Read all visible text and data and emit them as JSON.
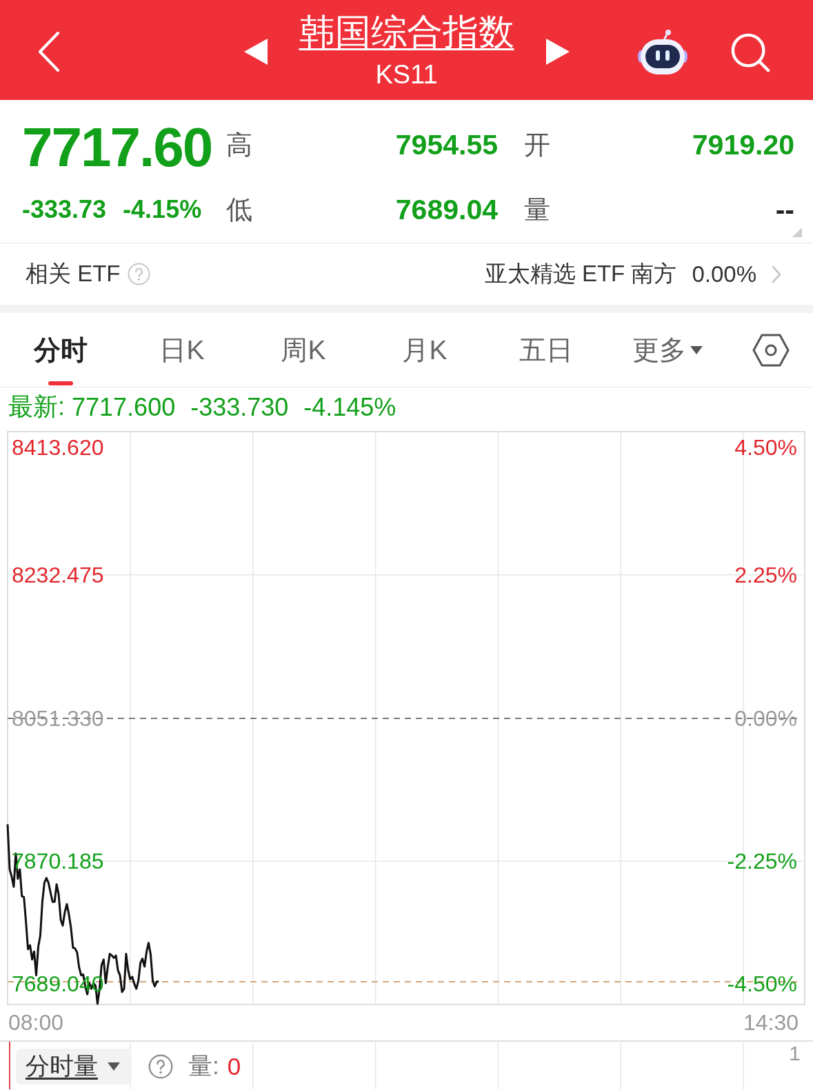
{
  "header": {
    "title": "韩国综合指数",
    "code": "KS11"
  },
  "quote": {
    "price": "7717.60",
    "change": "-333.73",
    "change_percent": "-4.15%",
    "stats": [
      {
        "label": "高",
        "value": "7954.55",
        "color": "#12a01a"
      },
      {
        "label": "开",
        "value": "7919.20",
        "color": "#12a01a"
      },
      {
        "label": "低",
        "value": "7689.04",
        "color": "#12a01a"
      },
      {
        "label": "量",
        "value": "--",
        "color": "#222222"
      }
    ]
  },
  "related_etf": {
    "label": "相关 ETF",
    "name": "亚太精选 ETF 南方",
    "change": "0.00%"
  },
  "tabs": [
    {
      "label": "分时",
      "selected": true,
      "kind": "tab"
    },
    {
      "label": "日K",
      "selected": false,
      "kind": "tab"
    },
    {
      "label": "周K",
      "selected": false,
      "kind": "tab"
    },
    {
      "label": "月K",
      "selected": false,
      "kind": "tab"
    },
    {
      "label": "五日",
      "selected": false,
      "kind": "tab"
    },
    {
      "label": "更多",
      "selected": false,
      "kind": "dropdown"
    }
  ],
  "intraday": {
    "latest": {
      "label": "最新:",
      "price": "7717.600",
      "change": "-333.730",
      "percent": "-4.145%"
    },
    "chart_data": {
      "type": "line",
      "categories": [
        null,
        null,
        null,
        null,
        null,
        null,
        null,
        null,
        null,
        null,
        null,
        null,
        null,
        null,
        null,
        null,
        null,
        null,
        null,
        null,
        null,
        null,
        null,
        null,
        null,
        null,
        null,
        null,
        null,
        null,
        null,
        null,
        null,
        null,
        null,
        null,
        null,
        null,
        null,
        null,
        null,
        null,
        null,
        null,
        null,
        null,
        null,
        null,
        null,
        null,
        null,
        null,
        null,
        null,
        null,
        null,
        null,
        null,
        null,
        null,
        null,
        null,
        null,
        null,
        null,
        null,
        null,
        null,
        null,
        null,
        null,
        null,
        null,
        null,
        null,
        null,
        null,
        null,
        null,
        null,
        null,
        null,
        null,
        null,
        null,
        null,
        null,
        null,
        null,
        null,
        null,
        null,
        null,
        null,
        null,
        null,
        null,
        null,
        null,
        null,
        null,
        null,
        null,
        null,
        null,
        null,
        null,
        null,
        null,
        null,
        null,
        null,
        null,
        null,
        null,
        null,
        null,
        null,
        null,
        null,
        null,
        null,
        null,
        null,
        null,
        null,
        null,
        null,
        null,
        null,
        null,
        null,
        null,
        null,
        null,
        null,
        null,
        null,
        null,
        null,
        null,
        null,
        null,
        null,
        null,
        null,
        null,
        null,
        null,
        null,
        null,
        null,
        null,
        null,
        null,
        null,
        null,
        null,
        null,
        null,
        null,
        null,
        null,
        null,
        null,
        null,
        null,
        null,
        null,
        null,
        null,
        null,
        null,
        null,
        null,
        null,
        null,
        null,
        null,
        null,
        null,
        null,
        null,
        null,
        null,
        null,
        null,
        null,
        null,
        null,
        null,
        null,
        null,
        null,
        null,
        null,
        null,
        null,
        null,
        null,
        null,
        null,
        null,
        null,
        null,
        null,
        null,
        null,
        null,
        null,
        null,
        null,
        null,
        null,
        null,
        null,
        null,
        null,
        null,
        null,
        null,
        null,
        null,
        null,
        null,
        null,
        null,
        null,
        null,
        null,
        null,
        null,
        null,
        null,
        null,
        null,
        null,
        null,
        null,
        null,
        null,
        null,
        null,
        null,
        null,
        null,
        null,
        null,
        null,
        null,
        null,
        null,
        null,
        null,
        null,
        null,
        null,
        null,
        null,
        null,
        null,
        null,
        null,
        null,
        null,
        null,
        null,
        null,
        null,
        null,
        null,
        null,
        null,
        null,
        null,
        null,
        null,
        null,
        null,
        null,
        null,
        null,
        null,
        null,
        null,
        null,
        null,
        null,
        null,
        null,
        null,
        null,
        null,
        null,
        null,
        null,
        null,
        null,
        null,
        null,
        null,
        null,
        null,
        null,
        null,
        null,
        null,
        null,
        null,
        null,
        null,
        null,
        null,
        null,
        null,
        null,
        null,
        null,
        null,
        null,
        null,
        null,
        null,
        null,
        null,
        null,
        null,
        null,
        null,
        null,
        null,
        null,
        null,
        null,
        null,
        null,
        null,
        null,
        null,
        null,
        null,
        null,
        null,
        null,
        null,
        null,
        null,
        null,
        null,
        null,
        null,
        null,
        null,
        null,
        null,
        null,
        null,
        null,
        null,
        null,
        null,
        null,
        null,
        null,
        null,
        null,
        null,
        null,
        null,
        null,
        null,
        null,
        null,
        null,
        null,
        null,
        null,
        null,
        null,
        null,
        null,
        null,
        null,
        null,
        null,
        null,
        null,
        null,
        null,
        null,
        null
      ],
      "series": [
        {
          "color": "#111111",
          "values": [
            7917,
            7860,
            7851,
            7838,
            7880,
            7848,
            7860,
            7826,
            7825,
            7793,
            7759,
            7764,
            7746,
            7756,
            7726,
            7762,
            7776,
            7819,
            7843,
            7849,
            7843,
            7831,
            7819,
            7819,
            7841,
            7828,
            7796,
            7789,
            7806,
            7816,
            7803,
            7786,
            7761,
            7760,
            7755,
            7736,
            7726,
            7727,
            7712,
            7702,
            7716,
            7709,
            7716,
            7713,
            7690,
            7709,
            7739,
            7746,
            7716,
            7736,
            7753,
            7751,
            7748,
            7751,
            7732,
            7726,
            7705,
            7709,
            7753,
            7732,
            7721,
            7724,
            7715,
            7709,
            7719,
            7742,
            7747,
            7737,
            7756,
            7767,
            7752,
            7719,
            7712,
            7718,
            7718,
            null,
            null,
            null,
            null,
            null,
            null,
            null,
            null,
            null,
            null,
            null,
            null,
            null,
            null,
            null,
            null,
            null,
            null,
            null,
            null,
            null,
            null,
            null,
            null,
            null,
            null,
            null,
            null,
            null,
            null,
            null,
            null,
            null,
            null,
            null,
            null,
            null,
            null,
            null,
            null,
            null,
            null,
            null,
            null,
            null,
            null,
            null,
            null,
            null,
            null,
            null,
            null,
            null,
            null,
            null,
            null,
            null,
            null,
            null,
            null,
            null,
            null,
            null,
            null,
            null,
            null,
            null,
            null,
            null,
            null,
            null,
            null,
            null,
            null,
            null,
            null,
            null,
            null,
            null,
            null,
            null,
            null,
            null,
            null,
            null,
            null,
            null,
            null,
            null,
            null,
            null,
            null,
            null,
            null,
            null,
            null,
            null,
            null,
            null,
            null,
            null,
            null,
            null,
            null,
            null,
            null,
            null,
            null,
            null,
            null,
            null,
            null,
            null,
            null,
            null,
            null,
            null,
            null,
            null,
            null,
            null,
            null,
            null,
            null,
            null,
            null,
            null,
            null,
            null,
            null,
            null,
            null,
            null,
            null,
            null,
            null,
            null,
            null,
            null,
            null,
            null,
            null,
            null,
            null,
            null,
            null,
            null,
            null,
            null,
            null,
            null,
            null,
            null,
            null,
            null,
            null,
            null,
            null,
            null,
            null,
            null,
            null,
            null,
            null,
            null,
            null,
            null,
            null,
            null,
            null,
            null,
            null,
            null,
            null,
            null,
            null,
            null,
            null,
            null,
            null,
            null,
            null,
            null,
            null,
            null,
            null,
            null,
            null,
            null,
            null,
            null,
            null,
            null,
            null,
            null,
            null,
            null,
            null,
            null,
            null,
            null,
            null,
            null,
            null,
            null,
            null,
            null,
            null,
            null,
            null,
            null,
            null,
            null,
            null,
            null,
            null,
            null,
            null,
            null,
            null,
            null,
            null,
            null,
            null,
            null,
            null,
            null,
            null,
            null,
            null,
            null,
            null,
            null,
            null,
            null,
            null,
            null,
            null,
            null,
            null,
            null,
            null,
            null,
            null,
            null,
            null,
            null,
            null,
            null,
            null,
            null,
            null,
            null,
            null,
            null,
            null,
            null,
            null,
            null,
            null,
            null,
            null,
            null,
            null,
            null,
            null,
            null,
            null,
            null,
            null,
            null,
            null,
            null,
            null,
            null,
            null,
            null,
            null,
            null,
            null,
            null,
            null,
            null,
            null,
            null,
            null,
            null,
            null,
            null,
            null,
            null,
            null,
            null,
            null,
            null,
            null,
            null,
            null,
            null,
            null,
            null,
            null,
            null,
            null,
            null,
            null,
            null,
            null,
            null,
            null,
            null,
            null,
            null,
            null,
            null,
            null
          ]
        }
      ],
      "ylim": [
        7689.04,
        8413.62
      ],
      "yticks": [
        {
          "value": 8232.475,
          "label": "8232.475"
        },
        {
          "value": 8051.33,
          "label": "8051.330"
        },
        {
          "value": 7870.185,
          "label": "7870.185"
        }
      ],
      "ref_lines": [
        {
          "axis": "y",
          "value": 8051.33,
          "color": "#7a7a7a"
        },
        {
          "axis": "y",
          "value": 7718,
          "color": "#d2a679"
        }
      ]
    },
    "axis_top_label": "8413.620",
    "axis_bottom_label": "7689.040",
    "right_labels": [
      "4.50%",
      "2.25%",
      "0.00%",
      "-2.25%",
      "-4.50%"
    ],
    "time_labels": [
      "08:00",
      "14:30"
    ]
  },
  "volume": {
    "indicator": "分时量",
    "label": "量:",
    "value": "0",
    "axis_max": "1"
  }
}
